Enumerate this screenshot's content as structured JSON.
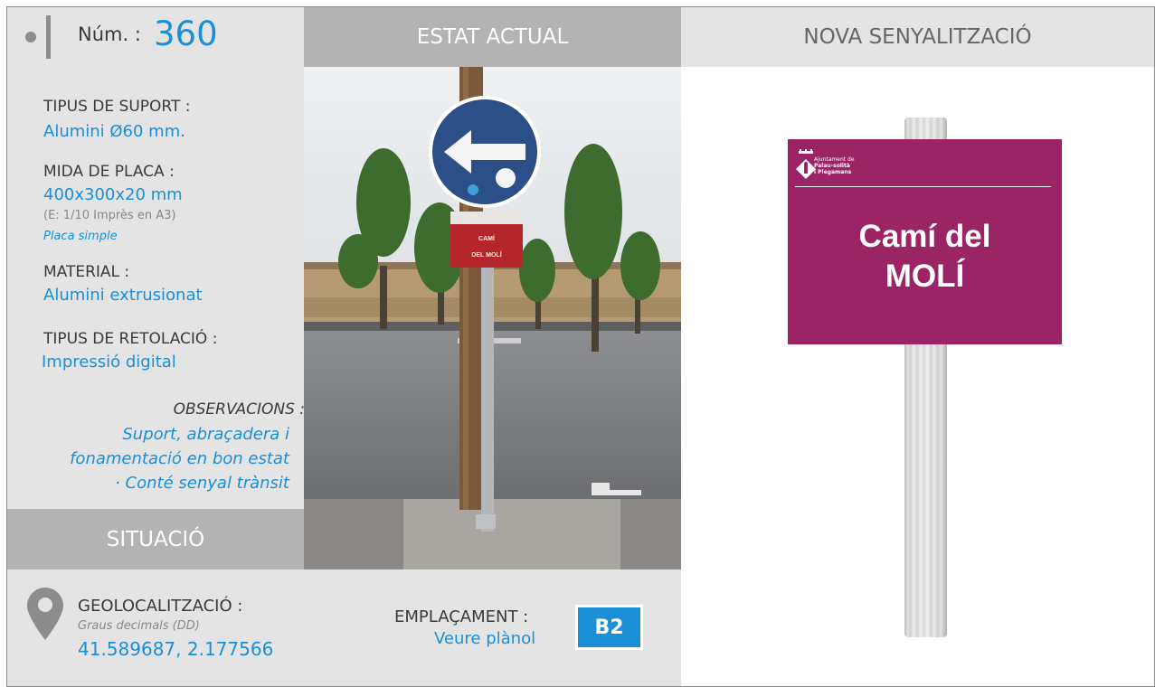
{
  "header": {
    "num_label": "Núm. :",
    "num_value": "360",
    "estat_actual": "ESTAT ACTUAL",
    "nova_senyalitzacio": "NOVA SENYALITZACIÓ"
  },
  "specs": {
    "suport_label": "TIPUS DE SUPORT :",
    "suport_value": "Alumini Ø60 mm.",
    "placa_label": "MIDA DE PLACA :",
    "placa_value": "400x300x20 mm",
    "placa_scale": "(E: 1/10 Imprès en A3)",
    "placa_type": "Placa simple",
    "material_label": "MATERIAL :",
    "material_value": "Alumini extrusionat",
    "retolacio_label": "TIPUS DE RETOLACIÓ :",
    "retolacio_value": "Impressió digital",
    "observacions_label": "OBSERVACIONS :",
    "observacions_lines": [
      "Suport, abraçadera i",
      "fonamentació en bon estat",
      "· Conté senyal trànsit"
    ]
  },
  "situacio": {
    "title": "SITUACIÓ",
    "geo_label": "GEOLOCALITZACIÓ :",
    "geo_sub": "Graus decimals (DD)",
    "geo_value": "41.589687, 2.177566",
    "empl_label": "EMPLAÇAMENT :",
    "empl_link": "Veure plànol",
    "empl_code": "B2"
  },
  "photo_sign": {
    "line1": "CAMÍ",
    "line2": "DEL MOLÍ"
  },
  "new_sign": {
    "org_line1": "Ajuntament de",
    "org_line2": "Palau-solità",
    "org_line3": "i Plegamans",
    "text_line1": "Camí del",
    "text_line2": "MOLÍ",
    "color": "#9b2467"
  },
  "colors": {
    "accent": "#1a8fd8",
    "panel": "#e4e4e4",
    "header_grey": "#b3b3b3"
  },
  "icons": {
    "location": "map-pin-icon",
    "num_marker": "dot-line-icon"
  }
}
